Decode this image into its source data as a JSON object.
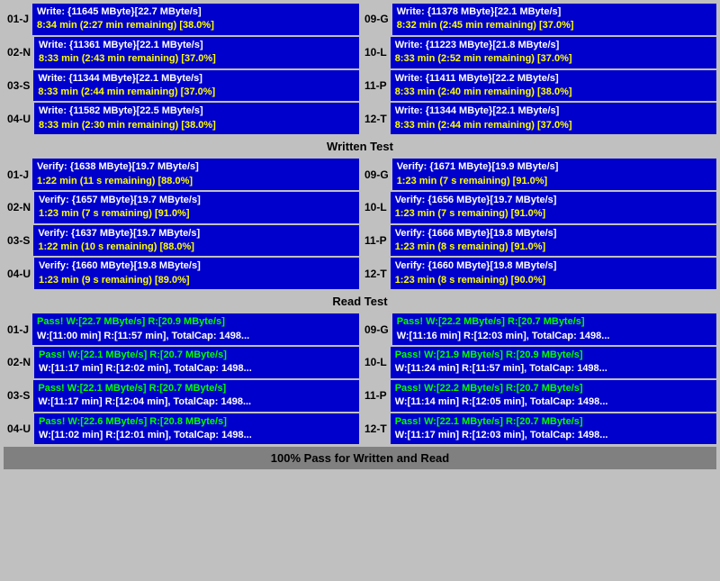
{
  "sections": {
    "write": {
      "label": "Written Test",
      "rows": [
        {
          "left": {
            "id": "01-J",
            "line1": "Write: {11645 MByte}[22.7 MByte/s]",
            "line2": "8:34 min (2:27 min remaining)  [38.0%]"
          },
          "right": {
            "id": "09-G",
            "line1": "Write: {11378 MByte}[22.1 MByte/s]",
            "line2": "8:32 min (2:45 min remaining)  [37.0%]"
          }
        },
        {
          "left": {
            "id": "02-N",
            "line1": "Write: {11361 MByte}[22.1 MByte/s]",
            "line2": "8:33 min (2:43 min remaining)  [37.0%]"
          },
          "right": {
            "id": "10-L",
            "line1": "Write: {11223 MByte}[21.8 MByte/s]",
            "line2": "8:33 min (2:52 min remaining)  [37.0%]"
          }
        },
        {
          "left": {
            "id": "03-S",
            "line1": "Write: {11344 MByte}[22.1 MByte/s]",
            "line2": "8:33 min (2:44 min remaining)  [37.0%]"
          },
          "right": {
            "id": "11-P",
            "line1": "Write: {11411 MByte}[22.2 MByte/s]",
            "line2": "8:33 min (2:40 min remaining)  [38.0%]"
          }
        },
        {
          "left": {
            "id": "04-U",
            "line1": "Write: {11582 MByte}[22.5 MByte/s]",
            "line2": "8:33 min (2:30 min remaining)  [38.0%]"
          },
          "right": {
            "id": "12-T",
            "line1": "Write: {11344 MByte}[22.1 MByte/s]",
            "line2": "8:33 min (2:44 min remaining)  [37.0%]"
          }
        }
      ]
    },
    "verify": {
      "label": "Written Test",
      "rows": [
        {
          "left": {
            "id": "01-J",
            "line1": "Verify: {1638 MByte}[19.7 MByte/s]",
            "line2": "1:22 min (11 s remaining)   [88.0%]"
          },
          "right": {
            "id": "09-G",
            "line1": "Verify: {1671 MByte}[19.9 MByte/s]",
            "line2": "1:23 min (7 s remaining)   [91.0%]"
          }
        },
        {
          "left": {
            "id": "02-N",
            "line1": "Verify: {1657 MByte}[19.7 MByte/s]",
            "line2": "1:23 min (7 s remaining)   [91.0%]"
          },
          "right": {
            "id": "10-L",
            "line1": "Verify: {1656 MByte}[19.7 MByte/s]",
            "line2": "1:23 min (7 s remaining)   [91.0%]"
          }
        },
        {
          "left": {
            "id": "03-S",
            "line1": "Verify: {1637 MByte}[19.7 MByte/s]",
            "line2": "1:22 min (10 s remaining)   [88.0%]"
          },
          "right": {
            "id": "11-P",
            "line1": "Verify: {1666 MByte}[19.8 MByte/s]",
            "line2": "1:23 min (8 s remaining)   [91.0%]"
          }
        },
        {
          "left": {
            "id": "04-U",
            "line1": "Verify: {1660 MByte}[19.8 MByte/s]",
            "line2": "1:23 min (9 s remaining)   [89.0%]"
          },
          "right": {
            "id": "12-T",
            "line1": "Verify: {1660 MByte}[19.8 MByte/s]",
            "line2": "1:23 min (8 s remaining)   [90.0%]"
          }
        }
      ]
    },
    "read": {
      "label": "Read Test",
      "rows": [
        {
          "left": {
            "id": "01-J",
            "line1": "Pass! W:[22.7 MByte/s] R:[20.9 MByte/s]",
            "line2": "W:[11:00 min] R:[11:57 min], TotalCap: 1498..."
          },
          "right": {
            "id": "09-G",
            "line1": "Pass! W:[22.2 MByte/s] R:[20.7 MByte/s]",
            "line2": "W:[11:16 min] R:[12:03 min], TotalCap: 1498..."
          }
        },
        {
          "left": {
            "id": "02-N",
            "line1": "Pass! W:[22.1 MByte/s] R:[20.7 MByte/s]",
            "line2": "W:[11:17 min] R:[12:02 min], TotalCap: 1498..."
          },
          "right": {
            "id": "10-L",
            "line1": "Pass! W:[21.9 MByte/s] R:[20.9 MByte/s]",
            "line2": "W:[11:24 min] R:[11:57 min], TotalCap: 1498..."
          }
        },
        {
          "left": {
            "id": "03-S",
            "line1": "Pass! W:[22.1 MByte/s] R:[20.7 MByte/s]",
            "line2": "W:[11:17 min] R:[12:04 min], TotalCap: 1498..."
          },
          "right": {
            "id": "11-P",
            "line1": "Pass! W:[22.2 MByte/s] R:[20.7 MByte/s]",
            "line2": "W:[11:14 min] R:[12:05 min], TotalCap: 1498..."
          }
        },
        {
          "left": {
            "id": "04-U",
            "line1": "Pass! W:[22.6 MByte/s] R:[20.8 MByte/s]",
            "line2": "W:[11:02 min] R:[12:01 min], TotalCap: 1498..."
          },
          "right": {
            "id": "12-T",
            "line1": "Pass! W:[22.1 MByte/s] R:[20.7 MByte/s]",
            "line2": "W:[11:17 min] R:[12:03 min], TotalCap: 1498..."
          }
        }
      ]
    }
  },
  "labels": {
    "written_test": "Written Test",
    "read_test": "Read Test",
    "final_status": "100% Pass for Written and Read"
  }
}
